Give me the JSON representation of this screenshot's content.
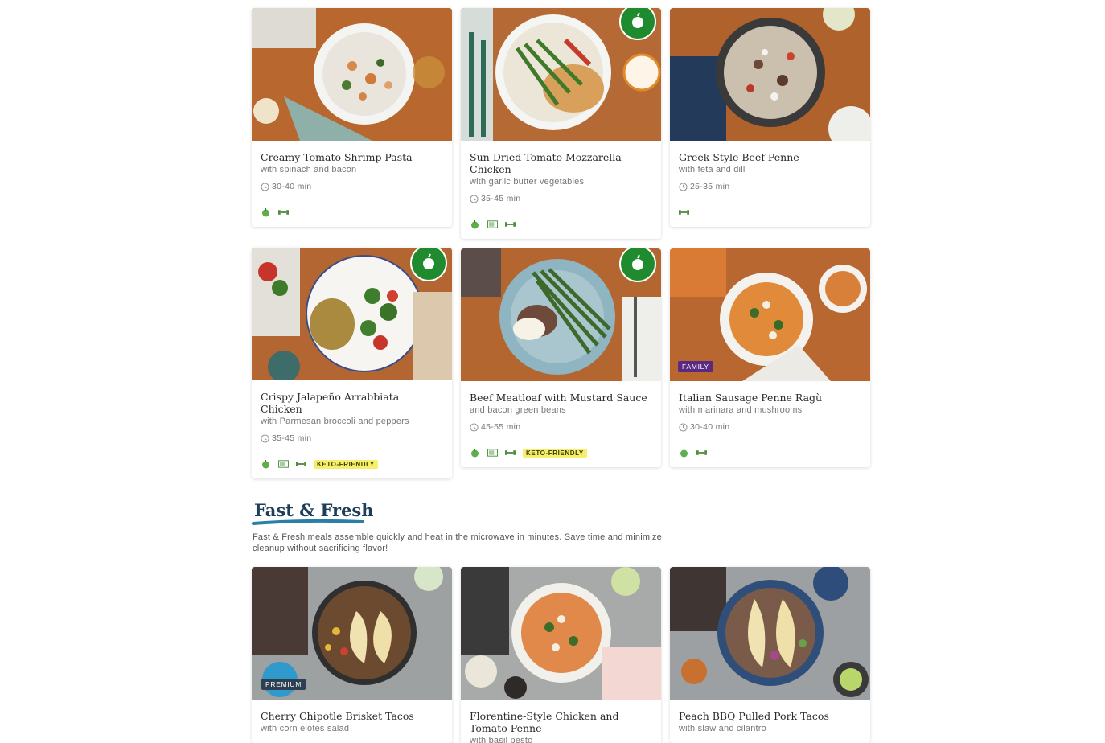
{
  "recipes": [
    {
      "title": "Creamy Tomato Shrimp Pasta",
      "subtitle": "with spinach and bacon",
      "time": "30-40 min",
      "fresh_start": false,
      "tag": "",
      "keto": ""
    },
    {
      "title": "Sun-Dried Tomato Mozzarella Chicken",
      "subtitle": "with garlic butter vegetables",
      "time": "35-45 min",
      "fresh_start": true,
      "tag": "",
      "keto": ""
    },
    {
      "title": "Greek-Style Beef Penne",
      "subtitle": "with feta and dill",
      "time": "25-35 min",
      "fresh_start": false,
      "tag": "",
      "keto": ""
    },
    {
      "title": "Crispy Jalapeño Arrabbiata Chicken",
      "subtitle": "with Parmesan broccoli and peppers",
      "time": "35-45 min",
      "fresh_start": true,
      "tag": "",
      "keto": "KETO-FRIENDLY"
    },
    {
      "title": "Beef Meatloaf with Mustard Sauce",
      "subtitle": "and bacon green beans",
      "time": "45-55 min",
      "fresh_start": true,
      "tag": "",
      "keto": "KETO-FRIENDLY"
    },
    {
      "title": "Italian Sausage Penne Ragù",
      "subtitle": "with marinara and mushrooms",
      "time": "30-40 min",
      "fresh_start": false,
      "tag": "FAMILY",
      "keto": ""
    }
  ],
  "fast_fresh": {
    "title": "Fast & Fresh",
    "description": "Fast & Fresh meals assemble quickly and heat in the microwave in minutes. Save time and minimize cleanup without sacrificing flavor!",
    "recipes": [
      {
        "title": "Cherry Chipotle Brisket Tacos",
        "subtitle": "with corn elotes salad",
        "tag": "PREMIUM"
      },
      {
        "title": "Florentine-Style Chicken and Tomato Penne",
        "subtitle": "with basil pesto",
        "tag": ""
      },
      {
        "title": "Peach BBQ Pulled Pork Tacos",
        "subtitle": "with slaw and cilantro",
        "tag": ""
      }
    ]
  },
  "badges": {
    "fresh_start": "FRESH START"
  },
  "colors": {
    "fresh_green": "#1f8a2e",
    "family_tag": "#5a2a82",
    "premium_tag": "#2e3f52",
    "keto_bg": "#f6ef6b",
    "heading_underline": "#2a7fa6"
  },
  "icons": [
    "apple-icon",
    "microwave-icon",
    "dumbbell-icon",
    "clock-icon"
  ]
}
